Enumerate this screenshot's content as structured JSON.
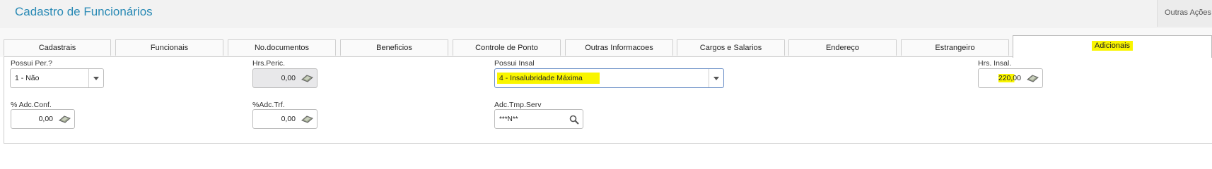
{
  "header": {
    "title": "Cadastro de Funcionários",
    "outras_acoes": "Outras Ações"
  },
  "tabs": [
    {
      "label": "Cadastrais"
    },
    {
      "label": "Funcionais"
    },
    {
      "label": "No.documentos"
    },
    {
      "label": "Beneficios"
    },
    {
      "label": "Controle de Ponto"
    },
    {
      "label": "Outras Informacoes"
    },
    {
      "label": "Cargos e Salarios"
    },
    {
      "label": "Endereço"
    },
    {
      "label": "Estrangeiro"
    },
    {
      "label": "Adicionais",
      "active": true
    }
  ],
  "form": {
    "possui_per": {
      "label": "Possui Per.?",
      "value": "1 - Não"
    },
    "hrs_peric": {
      "label": "Hrs.Peric.",
      "value": "0,00"
    },
    "possui_insal": {
      "label": "Possui Insal",
      "value": "4 - Insalubridade Máxima"
    },
    "hrs_insal": {
      "label": "Hrs. Insal.",
      "value": "220,00"
    },
    "adc_conf": {
      "label": "% Adc.Conf.",
      "value": "0,00"
    },
    "adc_trf": {
      "label": "%Adc.Trf.",
      "value": "0,00"
    },
    "adc_tmp_serv": {
      "label": "Adc.Tmp.Serv",
      "value": "***N**"
    }
  },
  "colors": {
    "title": "#2a8ab5",
    "highlight": "#f9f500"
  },
  "icons": {
    "calculator": "calculator-icon",
    "search": "search-icon",
    "dropdown": "chevron-down-icon"
  }
}
